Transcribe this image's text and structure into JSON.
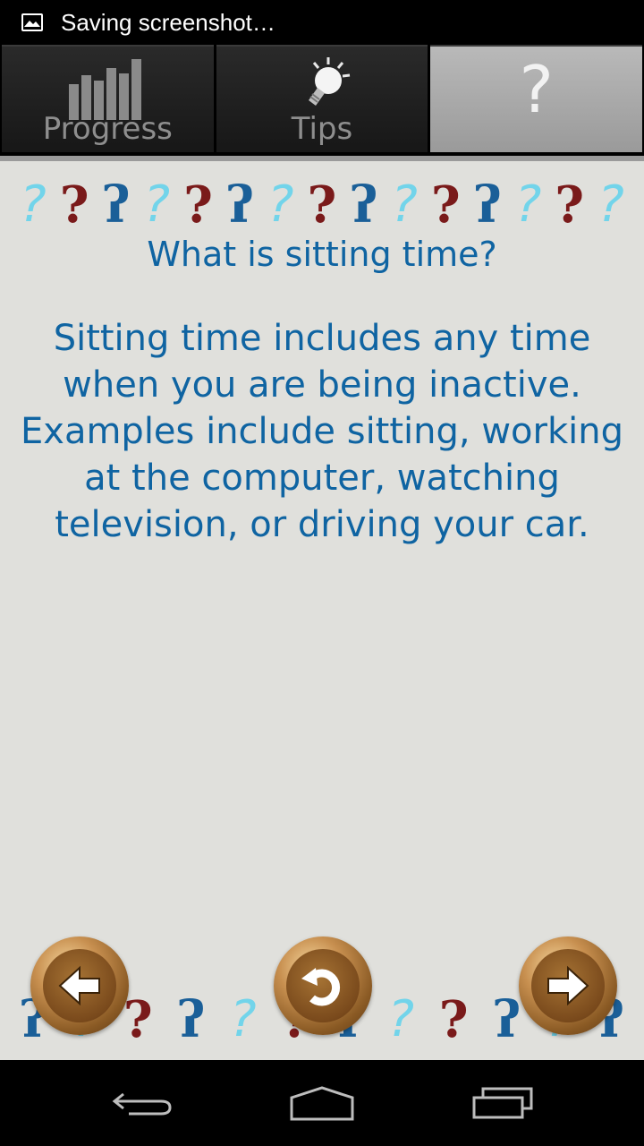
{
  "status_bar": {
    "text": "Saving screenshot…",
    "icon": "image-icon"
  },
  "tabs": [
    {
      "label": "Progress",
      "icon": "bar-chart-icon",
      "active": false
    },
    {
      "label": "Tips",
      "icon": "lightbulb-icon",
      "active": false
    },
    {
      "label": "?",
      "icon": "question-icon",
      "active": true
    }
  ],
  "content": {
    "title": "What is sitting time?",
    "body": "Sitting time includes any time when you are being inactive. Examples include sitting, working at the computer, watching television, or driving your car."
  },
  "nav_buttons": [
    {
      "name": "previous",
      "icon": "arrow-left-icon"
    },
    {
      "name": "restart",
      "icon": "undo-icon"
    },
    {
      "name": "next",
      "icon": "arrow-right-icon"
    }
  ],
  "system_nav": [
    "back-icon",
    "home-icon",
    "recents-icon"
  ],
  "colors": {
    "text": "#0f64a2",
    "background": "#e0e0dc",
    "red_mark": "#7a1a1a",
    "cyan_mark": "#72d4ea"
  }
}
